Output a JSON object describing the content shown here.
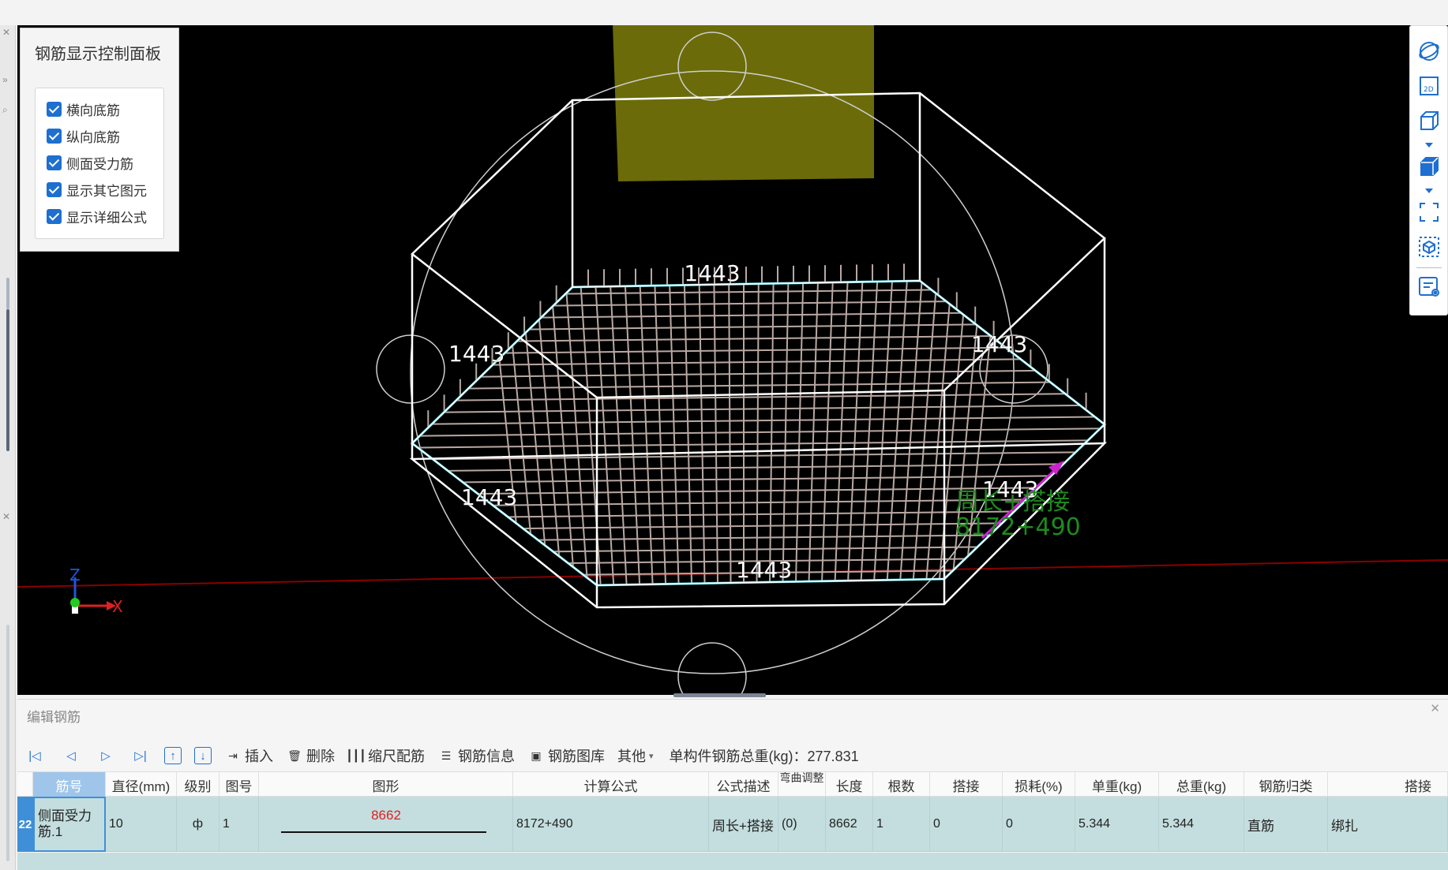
{
  "control_panel": {
    "title": "钢筋显示控制面板",
    "options": [
      {
        "label": "横向底筋",
        "checked": true
      },
      {
        "label": "纵向底筋",
        "checked": true
      },
      {
        "label": "侧面受力筋",
        "checked": true
      },
      {
        "label": "显示其它图元",
        "checked": true
      },
      {
        "label": "显示详细公式",
        "checked": true
      }
    ]
  },
  "viewport": {
    "dimension_labels": [
      "1443",
      "1443",
      "1443",
      "1443",
      "1443",
      "1443"
    ],
    "highlight_text": {
      "line1": "周长+搭接",
      "line2": "8172+490"
    },
    "axes": {
      "z": "Z",
      "x": "X"
    },
    "colors": {
      "background": "#000000",
      "edge": "#ffffff",
      "rebar_outline": "#22c8d8",
      "rebar_grid": "#b8a8a2",
      "column": "#6b6b0a",
      "highlight": "#1e8a1e",
      "arrow": "#cc22cc"
    }
  },
  "right_toolbar": {
    "icons": [
      "orbit-icon",
      "2d-view-icon",
      "3d-box-icon",
      "solid-box-icon",
      "fit-view-icon",
      "cube-select-icon",
      "rebar-info-view-icon"
    ],
    "label_2d": "2D"
  },
  "bottom_panel": {
    "title": "编辑钢筋",
    "toolbar": {
      "insert": "插入",
      "delete": "删除",
      "scale_rebar": "缩尺配筋",
      "rebar_info": "钢筋信息",
      "rebar_library": "钢筋图库",
      "other": "其他",
      "total_weight": "单构件钢筋总重(kg)：277.831"
    },
    "columns": [
      "筋号",
      "直径(mm)",
      "级别",
      "图号",
      "图形",
      "计算公式",
      "公式描述",
      "弯曲调整",
      "长度",
      "根数",
      "搭接",
      "损耗(%)",
      "单重(kg)",
      "总重(kg)",
      "钢筋归类",
      "搭接"
    ],
    "rows": [
      {
        "row_number": "22",
        "name": "侧面受力筋.1",
        "diameter": "10",
        "grade": "ф",
        "shape_no": "1",
        "shape_value": "8662",
        "formula": "8172+490",
        "formula_desc": "周长+搭接",
        "bend_adjust": "(0)",
        "length": "8662",
        "count": "1",
        "lap": "0",
        "loss": "0",
        "unit_weight": "5.344",
        "total_weight": "5.344",
        "category": "直筋",
        "lap_type": "绑扎"
      }
    ]
  }
}
